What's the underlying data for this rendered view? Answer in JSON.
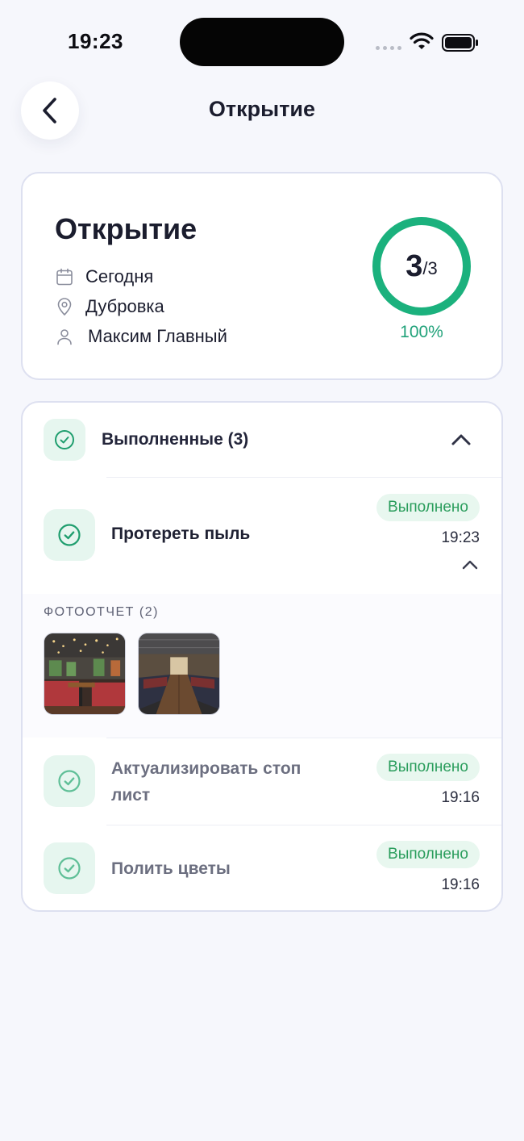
{
  "status_bar": {
    "time": "19:23"
  },
  "header": {
    "title": "Открытие"
  },
  "summary": {
    "title": "Открытие",
    "date": "Сегодня",
    "location": "Дубровка",
    "user": "Максим Главный",
    "progress": {
      "done": "3",
      "total": "/3",
      "percent_label": "100%",
      "fraction": 1.0
    }
  },
  "completed_section": {
    "title": "Выполненные (3)",
    "tasks": [
      {
        "title": "Протереть пыль",
        "status": "Выполнено",
        "time": "19:23",
        "expanded": true
      },
      {
        "title_line1": "Актуализировать стоп",
        "title_line2": "лист",
        "status": "Выполнено",
        "time": "19:16"
      },
      {
        "title": "Полить цветы",
        "status": "Выполнено",
        "time": "19:16"
      }
    ],
    "photo_report": {
      "label": "ФОТООТЧЕТ (2)"
    }
  },
  "colors": {
    "accent_green": "#1bb17d",
    "badge_text": "#2a9d5c",
    "badge_bg": "#e8f7ef",
    "background": "#f6f7fc"
  }
}
